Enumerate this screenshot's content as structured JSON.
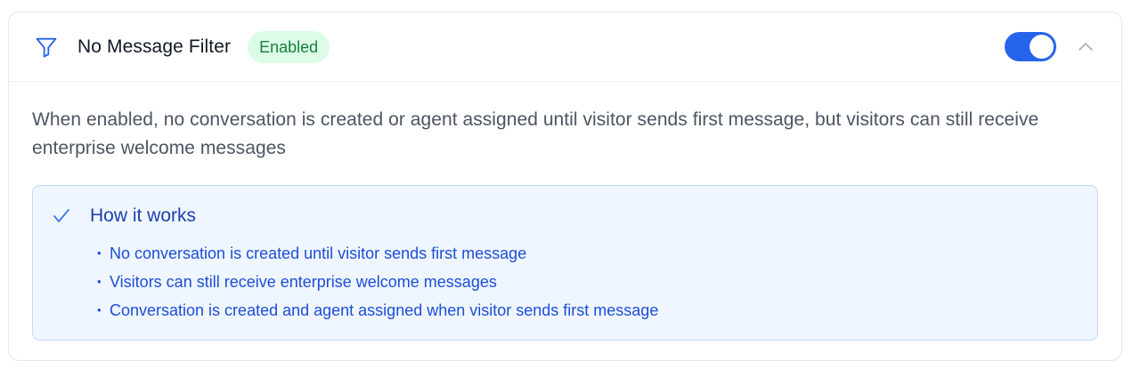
{
  "header": {
    "title": "No Message Filter",
    "badge": "Enabled",
    "toggle_on": true,
    "icon": "filter-icon",
    "collapse_icon": "chevron-up-icon"
  },
  "body": {
    "description": "When enabled, no conversation is created or agent assigned until visitor sends first message, but visitors can still receive enterprise welcome messages"
  },
  "info": {
    "icon": "check-icon",
    "title": "How it works",
    "items": [
      "No conversation is created until visitor sends first message",
      "Visitors can still receive enterprise welcome messages",
      "Conversation is created and agent assigned when visitor sends first message"
    ]
  },
  "colors": {
    "accent": "#2563eb",
    "badge_bg": "#dcfce7",
    "badge_text": "#15803d",
    "info_bg": "#eff6ff",
    "info_text": "#1d4ed8"
  }
}
